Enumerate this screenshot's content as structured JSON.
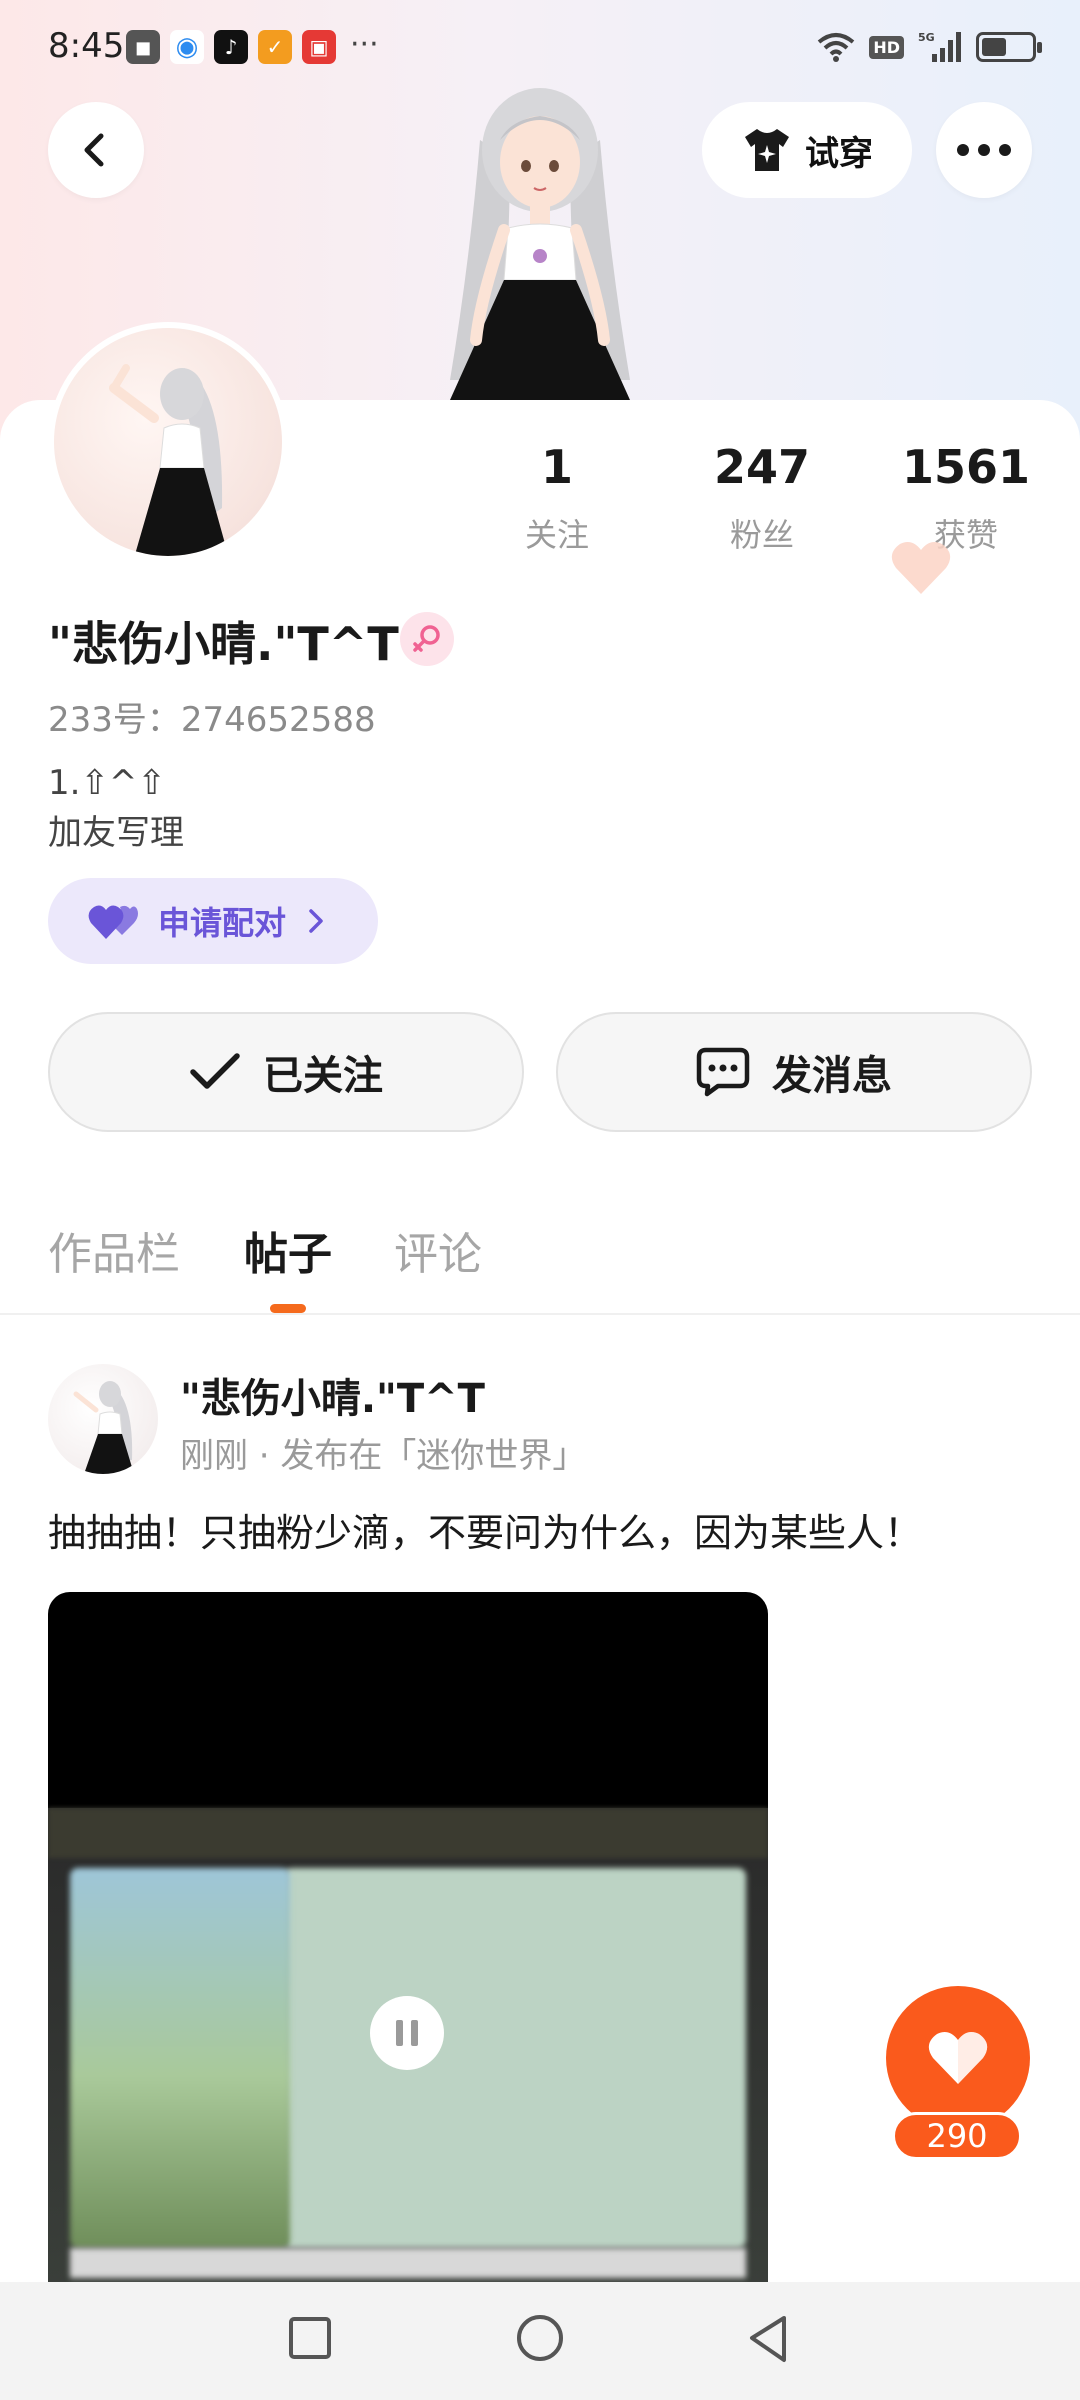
{
  "status_bar": {
    "time": "8:45",
    "more_indicator": "···",
    "network_badge": "HD",
    "signal_label": "5G"
  },
  "header": {
    "tryon_label": "试穿"
  },
  "profile": {
    "name": "\"悲伤小晴.\"T^T",
    "user_id": "233号：274652588",
    "bio_lines": [
      "1.⇧^⇧",
      "加友写理"
    ],
    "gender": "female"
  },
  "stats": {
    "following": {
      "value": "1",
      "label": "关注"
    },
    "fans": {
      "value": "247",
      "label": "粉丝"
    },
    "likes": {
      "value": "1561",
      "label": "获赞"
    }
  },
  "pair_button": {
    "label": "申请配对"
  },
  "actions": {
    "followed_label": "已关注",
    "message_label": "发消息"
  },
  "tabs": [
    {
      "label": "作品栏",
      "active": false
    },
    {
      "label": "帖子",
      "active": true
    },
    {
      "label": "评论",
      "active": false
    }
  ],
  "post": {
    "author": "\"悲伤小晴.\"T^T",
    "meta": "刚刚 · 发布在「迷你世界」",
    "text": "抽抽抽！只抽粉少滴，不要问为什么，因为某些人！"
  },
  "like_fab": {
    "count": "290"
  },
  "colors": {
    "accent": "#fa5a1c",
    "tab_indicator": "#f56a1d",
    "pair_bg": "#ece8fb",
    "pair_text": "#6a55d8"
  }
}
